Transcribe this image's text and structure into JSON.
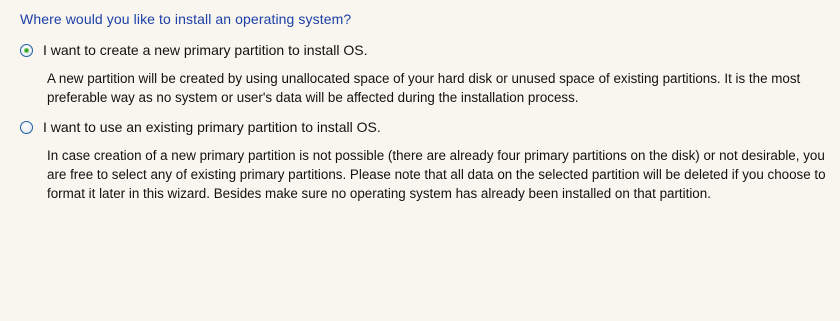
{
  "question": "Where would you like to install an operating system?",
  "options": [
    {
      "label": "I want to create a new primary partition to install OS.",
      "selected": true,
      "description": "A new partition will be created by using unallocated space of your hard disk or unused space of existing partitions. It is the most preferable way as no system or user's data will be affected during the installation process."
    },
    {
      "label": "I want to use an existing primary partition to install OS.",
      "selected": false,
      "description": "In case creation of a new primary partition is not possible (there are already four primary partitions on the disk) or not desirable, you are free to select any of existing primary partitions. Please note that all data on the selected partition will be deleted if you choose to format it later in this wizard. Besides make sure no operating system has already been installed on that partition."
    }
  ],
  "colors": {
    "question_text": "#1c3fa8",
    "background": "#f8f6ee",
    "radio_dot": "#2ea21f"
  }
}
